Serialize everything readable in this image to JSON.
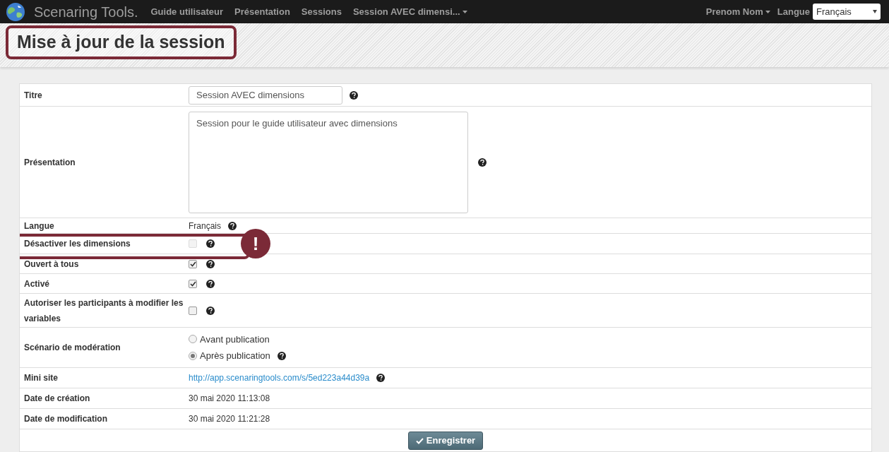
{
  "navbar": {
    "brand": "Scenaring Tools.",
    "links": [
      {
        "label": "Guide utilisateur",
        "dropdown": false
      },
      {
        "label": "Présentation",
        "dropdown": false
      },
      {
        "label": "Sessions",
        "dropdown": false
      },
      {
        "label": "Session AVEC dimensi...",
        "dropdown": true
      }
    ],
    "user": {
      "label": "Prenom Nom",
      "dropdown": true
    },
    "language": {
      "label": "Langue",
      "value": "Français"
    }
  },
  "page_title": "Mise à jour de la session",
  "form": {
    "rows": [
      {
        "kind": "input",
        "label": "Titre",
        "value": "Session AVEC dimensions",
        "help": true
      },
      {
        "kind": "textarea",
        "label": "Présentation",
        "value": "Session pour le guide utilisateur avec dimensions",
        "help": true
      },
      {
        "kind": "text",
        "label": "Langue",
        "value": "Français",
        "help": true
      },
      {
        "kind": "checkbox",
        "label": "Désactiver les dimensions",
        "checked": false,
        "disabled": true,
        "help": true,
        "highlighted": true
      },
      {
        "kind": "checkbox",
        "label": "Ouvert à tous",
        "checked": true,
        "disabled": false,
        "help": true
      },
      {
        "kind": "checkbox",
        "label": "Activé",
        "checked": true,
        "disabled": false,
        "help": true
      },
      {
        "kind": "checkbox",
        "label": "Autoriser les participants à modifier les variables",
        "checked": false,
        "disabled": false,
        "help": true
      },
      {
        "kind": "radio",
        "label": "Scénario de modération",
        "options": [
          {
            "label": "Avant publication",
            "selected": false
          },
          {
            "label": "Après publication",
            "selected": true
          }
        ],
        "help": true
      },
      {
        "kind": "link",
        "label": "Mini site",
        "value": "http://app.scenaringtools.com/s/5ed223a44d39a",
        "help": true
      },
      {
        "kind": "text",
        "label": "Date de création",
        "value": "30 mai 2020 11:13:08",
        "help": false
      },
      {
        "kind": "text",
        "label": "Date de modification",
        "value": "30 mai 2020 11:21:28",
        "help": false
      }
    ],
    "submit": "Enregistrer"
  },
  "annotation": {
    "mark": "!"
  }
}
